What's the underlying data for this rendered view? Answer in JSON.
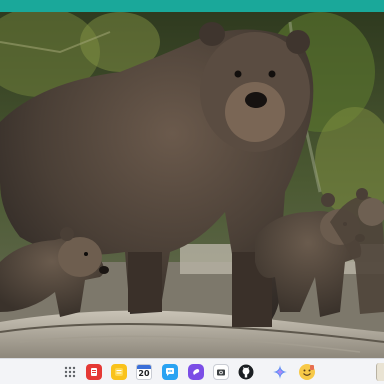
{
  "taskbar": {
    "icons": [
      "app-grid-icon",
      "red-app-icon",
      "notes-icon",
      "calendar-icon",
      "messages-icon",
      "purple-app-icon",
      "camera-icon",
      "github-icon",
      "spark-icon",
      "emoji-icon"
    ],
    "calendar_day": "20"
  },
  "colors": {
    "top_bar": "#1aa89a",
    "taskbar_bg": "#f3f4f7"
  }
}
